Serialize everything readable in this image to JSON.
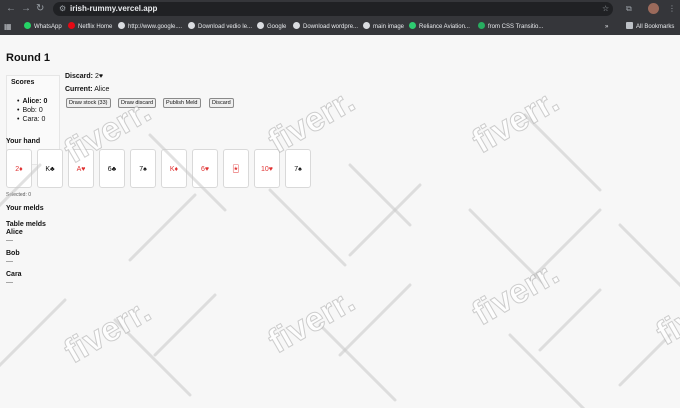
{
  "browser": {
    "url": "irish-rummy.vercel.app",
    "bookmarks": [
      {
        "label": "WhatsApp",
        "color": "#25d366"
      },
      {
        "label": "Netflix Home",
        "color": "#e50914"
      },
      {
        "label": "http://www.google....",
        "color": "#dadce0"
      },
      {
        "label": "Download vedio le...",
        "color": "#dadce0"
      },
      {
        "label": "Google",
        "color": "#dadce0"
      },
      {
        "label": "Download wordpre...",
        "color": "#dadce0"
      },
      {
        "label": "main image",
        "color": "#dadce0"
      },
      {
        "label": "Reliance Aviation...",
        "color": "#2ecc71"
      },
      {
        "label": "from CSS Transitio...",
        "color": "#27ae60"
      }
    ],
    "overflow_label": "»",
    "all_bookmarks": "All Bookmarks"
  },
  "game": {
    "round_title": "Round 1",
    "scores": {
      "heading": "Scores",
      "items": [
        {
          "name": "Alice:",
          "value": "0"
        },
        {
          "name": "Bob:",
          "value": "0"
        },
        {
          "name": "Cara:",
          "value": "0"
        }
      ]
    },
    "discard": {
      "label": "Discard:",
      "value": "2♥"
    },
    "current": {
      "label": "Current:",
      "value": "Alice"
    },
    "buttons": {
      "draw_stock": "Draw stock (33)",
      "draw_discard": "Draw discard",
      "publish_meld": "Publish Meld",
      "discard": "Discard"
    },
    "hand": {
      "title": "Your hand",
      "cards": [
        {
          "label": "2♦",
          "color": "#e03131"
        },
        {
          "label": "K♣",
          "color": "#111111"
        },
        {
          "label": "A♥",
          "color": "#e03131"
        },
        {
          "label": "6♣",
          "color": "#111111"
        },
        {
          "label": "7♠",
          "color": "#111111"
        },
        {
          "label": "K♦",
          "color": "#e03131"
        },
        {
          "label": "6♥",
          "color": "#e03131"
        },
        {
          "label": "🃏",
          "color": "#e03131"
        },
        {
          "label": "10♥",
          "color": "#e03131"
        },
        {
          "label": "7♠",
          "color": "#111111"
        }
      ],
      "selected": "Selected: 0"
    },
    "your_melds_title": "Your melds",
    "table_melds": {
      "title": "Table melds",
      "players": [
        {
          "name": "Alice",
          "melds": "—"
        },
        {
          "name": "Bob",
          "melds": "—"
        },
        {
          "name": "Cara",
          "melds": "—"
        }
      ]
    }
  },
  "watermark": "fiverr."
}
